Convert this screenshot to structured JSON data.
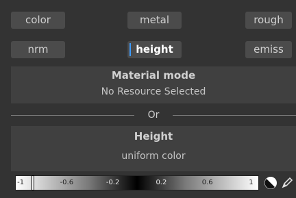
{
  "channels": [
    {
      "label": "color",
      "active": false
    },
    {
      "label": "metal",
      "active": false
    },
    {
      "label": "rough",
      "active": false
    },
    {
      "label": "nrm",
      "active": false
    },
    {
      "label": "height",
      "active": true
    },
    {
      "label": "emiss",
      "active": false
    }
  ],
  "material": {
    "title": "Material mode",
    "value": "No Resource Selected"
  },
  "separator": "Or",
  "height_panel": {
    "title": "Height",
    "value": "uniform color"
  },
  "ramp": {
    "ticks": [
      "-1",
      "-0.6",
      "-0.2",
      "0.2",
      "0.6",
      "1"
    ],
    "marker_value": -0.86
  },
  "tools": {
    "picker_icon": "color-picker-circle-icon",
    "pen_icon": "pencil-icon"
  },
  "colors": {
    "accent": "#3d9bff",
    "panel": "#404040",
    "button": "#4b4b4b",
    "background": "#333333"
  }
}
